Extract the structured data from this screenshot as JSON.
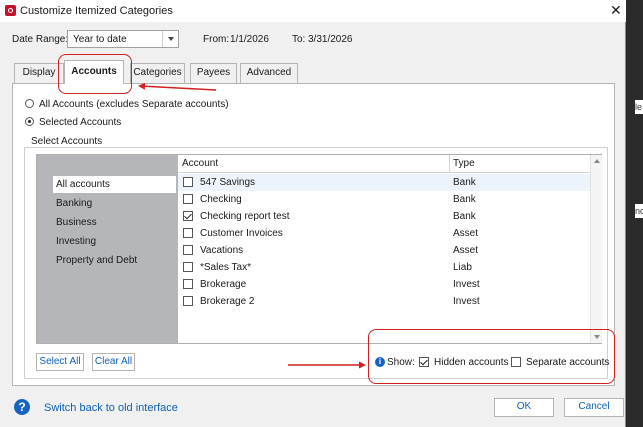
{
  "window": {
    "title": "Customize Itemized Categories",
    "close_glyph": "✕"
  },
  "date_range": {
    "label": "Date Range:",
    "value": "Year to date",
    "from_label": "From:",
    "from_value": "1/1/2026",
    "to_label": "To:",
    "to_value": "3/31/2026"
  },
  "tabs": [
    {
      "label": "Display"
    },
    {
      "label": "Accounts",
      "active": true
    },
    {
      "label": "Categories"
    },
    {
      "label": "Payees"
    },
    {
      "label": "Advanced"
    }
  ],
  "account_scope": {
    "options": [
      {
        "label": "All Accounts (excludes Separate accounts)",
        "selected": false
      },
      {
        "label": "Selected Accounts",
        "selected": true
      }
    ]
  },
  "select_accounts": {
    "group_label": "Select Accounts",
    "categories": [
      "All accounts",
      "Banking",
      "Business",
      "Investing",
      "Property and Debt"
    ],
    "selected_category": "All accounts",
    "columns": {
      "account": "Account",
      "type": "Type"
    },
    "rows": [
      {
        "account": "547 Savings",
        "type": "Bank",
        "checked": false
      },
      {
        "account": "Checking",
        "type": "Bank",
        "checked": false
      },
      {
        "account": "Checking report test",
        "type": "Bank",
        "checked": true
      },
      {
        "account": "Customer Invoices",
        "type": "Asset",
        "checked": false
      },
      {
        "account": "Vacations",
        "type": "Asset",
        "checked": false
      },
      {
        "account": "*Sales Tax*",
        "type": "Liab",
        "checked": false
      },
      {
        "account": "Brokerage",
        "type": "Invest",
        "checked": false
      },
      {
        "account": "Brokerage 2",
        "type": "Invest",
        "checked": false
      }
    ],
    "select_all_label": "Select All",
    "clear_all_label": "Clear All",
    "show_label": "Show:",
    "info_glyph": "i",
    "hidden_accounts": {
      "label": "Hidden accounts",
      "checked": true
    },
    "separate_accounts": {
      "label": "Separate accounts",
      "checked": false
    }
  },
  "footer": {
    "help_glyph": "?",
    "switch_link": "Switch back to old interface",
    "ok_label": "OK",
    "cancel_label": "Cancel"
  },
  "background": {
    "fragments": [
      "le",
      "nc"
    ]
  },
  "colors": {
    "annotation": "#d21f1f",
    "link": "#0f5fb5",
    "selected_row": "#edf3fa",
    "category_pane": "#b4b6b9",
    "brand": "#c8102e"
  }
}
